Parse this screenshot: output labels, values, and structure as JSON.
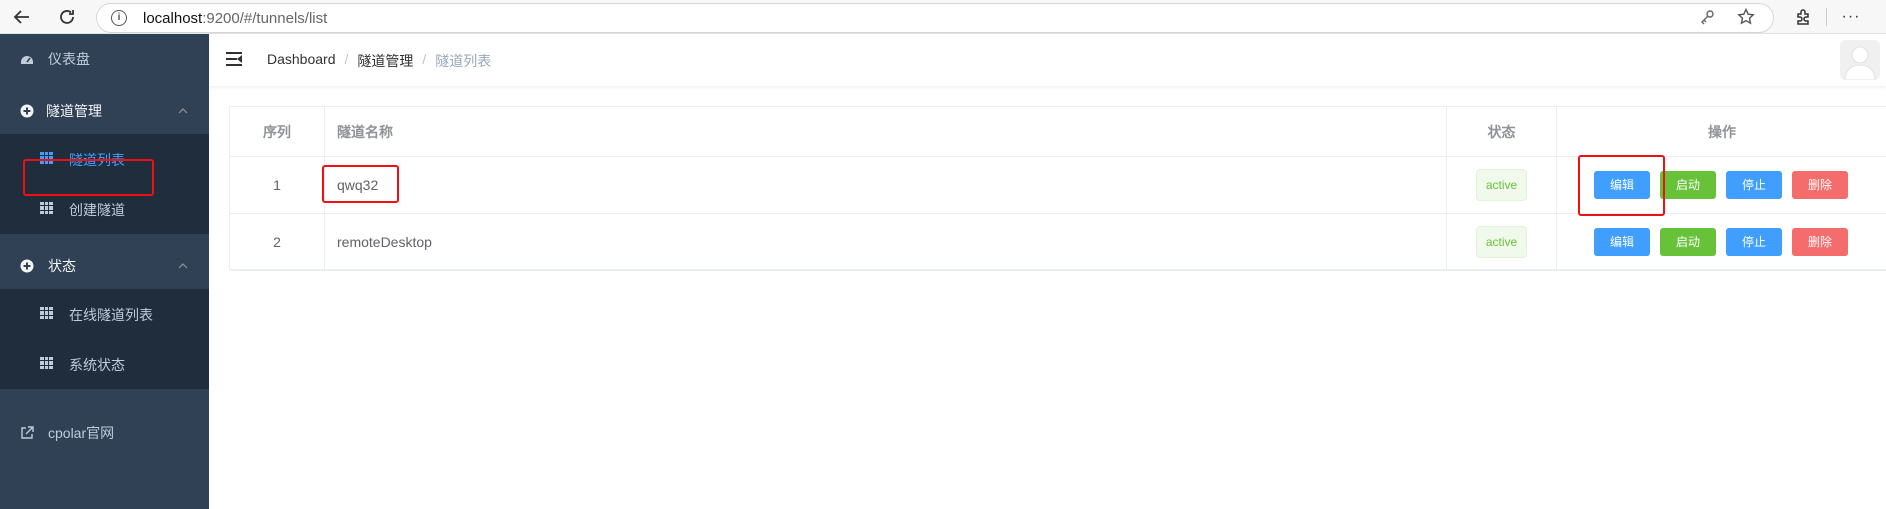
{
  "browser": {
    "back_icon": "arrow-left-icon",
    "reload_icon": "reload-icon",
    "info_icon": "info-icon",
    "url_host": "localhost",
    "url_rest": ":9200/#/tunnels/list"
  },
  "sidebar": {
    "dashboard": "仪表盘",
    "tunnel_mgmt": "隧道管理",
    "tunnel_list": "隧道列表",
    "create_tunnel": "创建隧道",
    "status": "状态",
    "online_tunnels": "在线隧道列表",
    "system_status": "系统状态",
    "cpolar_site": "cpolar官网"
  },
  "breadcrumb": {
    "item1": "Dashboard",
    "item2": "隧道管理",
    "item3": "隧道列表",
    "sep": "/"
  },
  "table": {
    "headers": {
      "index": "序列",
      "name": "隧道名称",
      "status": "状态",
      "actions": "操作"
    },
    "rows": [
      {
        "index": "1",
        "name": "qwq32",
        "status": "active"
      },
      {
        "index": "2",
        "name": "remoteDesktop",
        "status": "active"
      }
    ],
    "buttons": {
      "edit": "编辑",
      "start": "启动",
      "stop": "停止",
      "delete": "删除"
    }
  },
  "colors": {
    "sidebar_bg": "#304156",
    "submenu_bg": "#1f2d3d",
    "active": "#409eff",
    "success": "#67c23a",
    "danger": "#f56c6c",
    "annotation": "#ee1111"
  }
}
